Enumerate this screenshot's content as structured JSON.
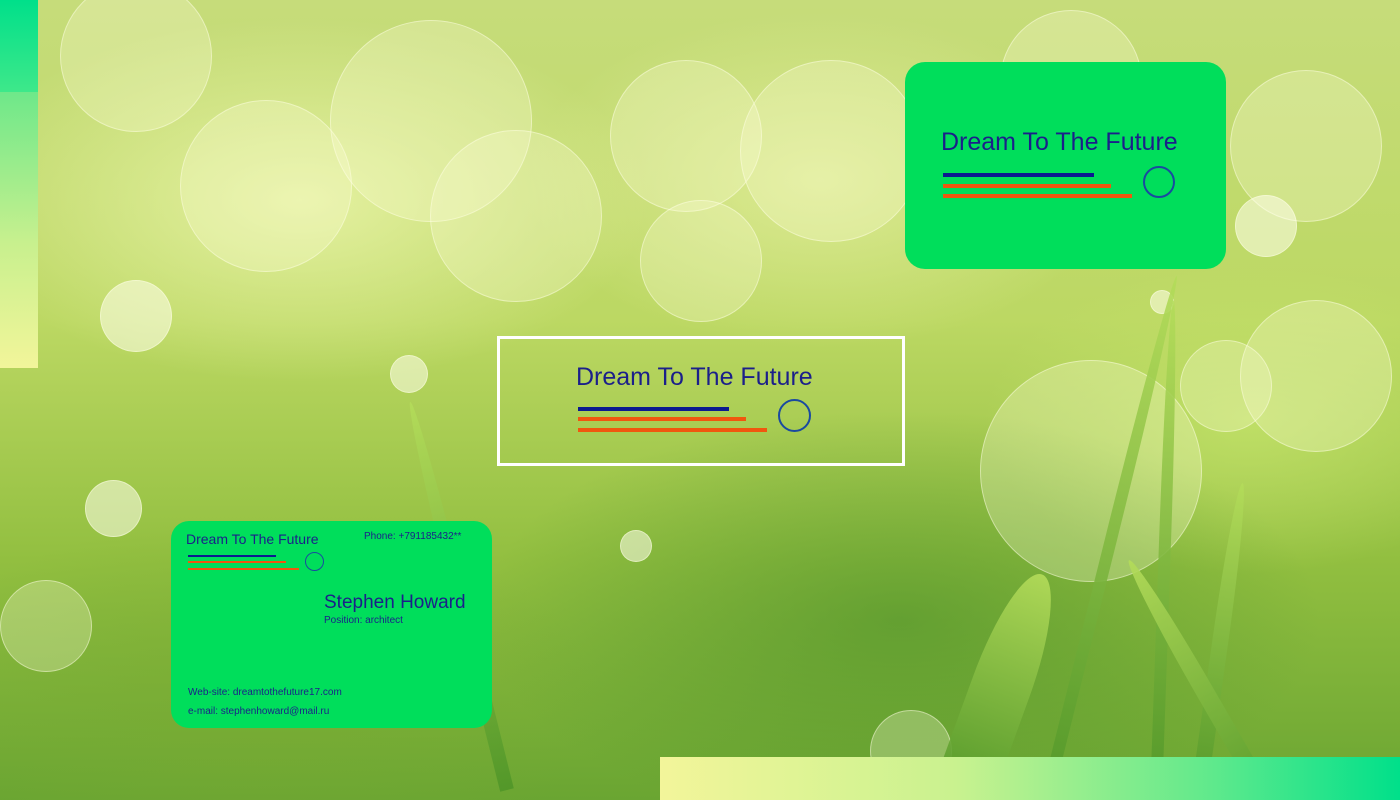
{
  "brand": "Dream To The Future",
  "business_card": {
    "brand": "Dream To The Future",
    "phone": "Phone: +791185432**",
    "name": "Stephen Howard",
    "position": "Position: architect",
    "website": "Web-site: dreamtothefuture17.com",
    "email": "e-mail: stephenhoward@mail.ru"
  },
  "colors": {
    "card_green": "#00de5b",
    "text_navy": "#1b1f8a",
    "line_orange": "#f0570e",
    "frame_white": "#ffffff"
  }
}
